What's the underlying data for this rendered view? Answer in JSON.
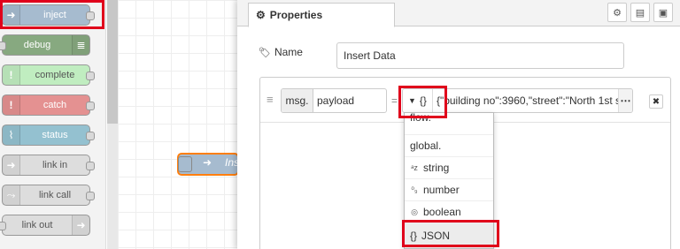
{
  "palette": {
    "nodes": [
      {
        "label": "inject"
      },
      {
        "label": "debug"
      },
      {
        "label": "complete"
      },
      {
        "label": "catch"
      },
      {
        "label": "status"
      },
      {
        "label": "link in"
      },
      {
        "label": "link call"
      },
      {
        "label": "link out"
      }
    ]
  },
  "workspace": {
    "node_label": "Ins"
  },
  "editor": {
    "tab_label": "Properties",
    "name_label": "Name",
    "name_value": "Insert Data",
    "property": {
      "prefix": "msg.",
      "field": "payload",
      "type_label": "{}",
      "value": "{\"building no\":3960,\"street\":\"North 1st s"
    }
  },
  "dropdown": {
    "items": [
      {
        "label": "flow.",
        "icon": ""
      },
      {
        "label": "global.",
        "icon": ""
      },
      {
        "label": "string",
        "icon": "az-icon"
      },
      {
        "label": "number",
        "icon": "09-icon"
      },
      {
        "label": "boolean",
        "icon": "toggle-icon"
      },
      {
        "label": "JSON",
        "icon": "braces-icon",
        "prefix": "{}"
      }
    ]
  },
  "colors": {
    "inject": "#a6bbcf",
    "debug": "#87a980",
    "complete": "#c0edc0",
    "catch": "#e49191",
    "status": "#94c1d0",
    "link": "#dddddd",
    "highlight": "#e0001b"
  }
}
